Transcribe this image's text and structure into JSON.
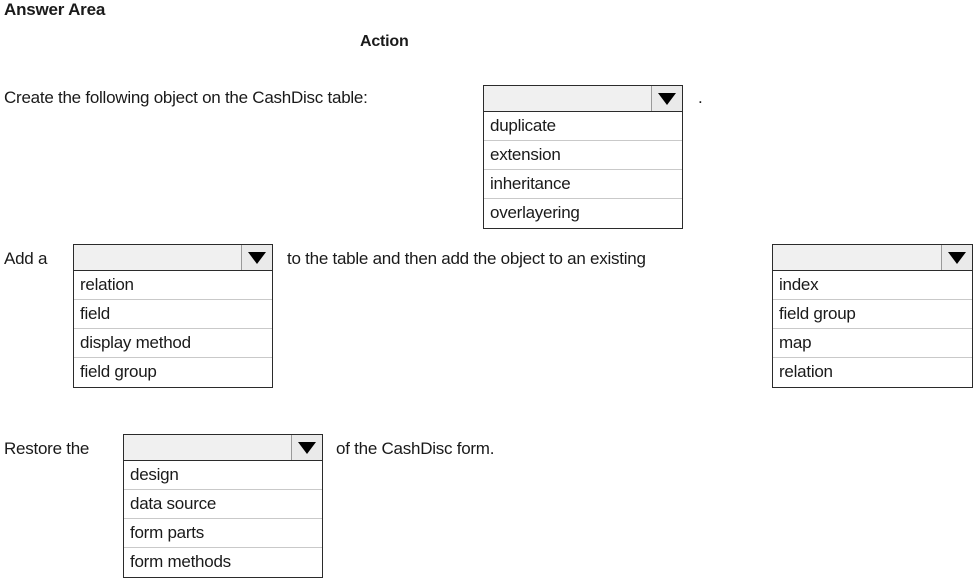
{
  "page": {
    "title": "Answer Area",
    "column_header": "Action"
  },
  "rows": [
    {
      "id": "create-object",
      "text_before": "Create the following object on the CashDisc table:",
      "text_after": ".",
      "dropdown": {
        "name": "object-type-dropdown",
        "value": "",
        "options": [
          "duplicate",
          "extension",
          "inheritance",
          "overlayering"
        ]
      }
    },
    {
      "id": "add-element",
      "text_before": "Add a",
      "text_middle": "to the table and then add the object to an existing",
      "dropdown_left": {
        "name": "element-type-dropdown",
        "value": "",
        "options": [
          "relation",
          "field",
          "display method",
          "field group"
        ]
      },
      "dropdown_right": {
        "name": "existing-target-dropdown",
        "value": "",
        "options": [
          "index",
          "field group",
          "map",
          "relation"
        ]
      }
    },
    {
      "id": "restore-form",
      "text_before": "Restore the",
      "text_after": "of the CashDisc form.",
      "dropdown": {
        "name": "form-part-dropdown",
        "value": "",
        "options": [
          "design",
          "data source",
          "form parts",
          "form methods"
        ]
      }
    }
  ]
}
